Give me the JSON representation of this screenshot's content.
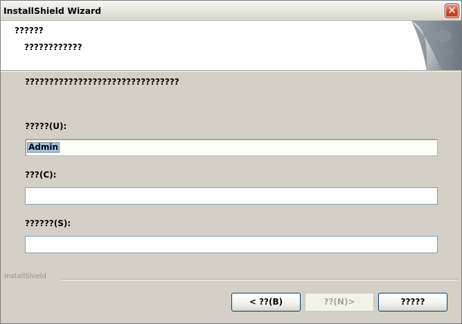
{
  "window": {
    "title": "InstallShield Wizard",
    "close_glyph": "✕"
  },
  "header": {
    "title": "??????",
    "subtitle": "????????????"
  },
  "instruction": "????????????????????????????????",
  "form": {
    "user": {
      "label": "?????(U):",
      "value": "Admin"
    },
    "company": {
      "label": "???(C):",
      "value": ""
    },
    "serial": {
      "label": "??????(S):",
      "value": ""
    }
  },
  "footer": {
    "brand": "InstallShield",
    "back_label": "< ??(B)",
    "next_label": "??(N)>",
    "cancel_label": "?????"
  },
  "colors": {
    "dialog_bg": "#d4d0c8",
    "button_border": "#003c74",
    "selection": "#a6c5e8"
  }
}
